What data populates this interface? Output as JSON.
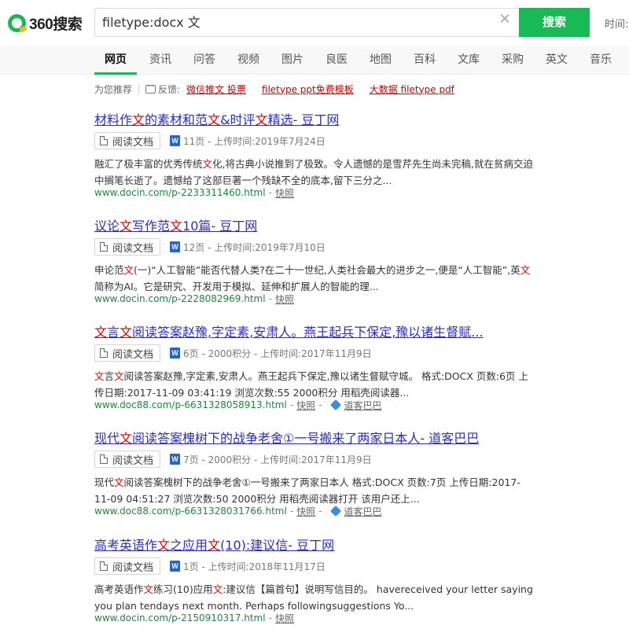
{
  "logo": {
    "text": "360搜索"
  },
  "search": {
    "query": "filetype:docx 文",
    "button_label": "搜索",
    "time_label": "时间:"
  },
  "nav": {
    "items": [
      "网页",
      "资讯",
      "问答",
      "视频",
      "图片",
      "良医",
      "地图",
      "百科",
      "文库",
      "采购",
      "英文",
      "音乐"
    ],
    "active": "网页"
  },
  "recommend": {
    "label": "为您推荐",
    "feedback_label": "反馈:",
    "links": [
      "微信推文 投票",
      "filetype ppt免费模板",
      "大数据 filetype pdf"
    ]
  },
  "results": [
    {
      "title_parts": [
        "材料作",
        "文",
        "的素材和范",
        "文",
        "&时评",
        "文",
        "精选- 豆丁网"
      ],
      "read_label": "阅读文档",
      "meta": "11页 - 上传时间:2019年7月24日",
      "snippet_parts": [
        "融汇了极丰富的优秀传统",
        "文",
        "化,将古典小说推到了极致。令人遗憾的是雪芹先生尚未完稿,就在贫病交迫中搁笔长逝了。遗憾给了这部巨著一个残缺不全的底本,留下三分之..."
      ],
      "url": "www.docin.com/p-2233311460.html",
      "snapshot": "快照",
      "site": ""
    },
    {
      "title_parts": [
        "议论",
        "文",
        "写作范",
        "文",
        "10篇- 豆丁网"
      ],
      "read_label": "阅读文档",
      "meta": "12页 - 上传时间:2019年7月10日",
      "snippet_parts": [
        "申论范",
        "文",
        "(一)“人工智能”能否代替人类?在二十一世纪,人类社会最大的进步之一,便是“人工智能”,英",
        "文",
        "简称为AI。它是研究、开发用于模拟、延伸和扩展人的智能的理..."
      ],
      "url": "www.docin.com/p-2228082969.html",
      "snapshot": "快照",
      "site": ""
    },
    {
      "title_parts": [
        "文",
        "言",
        "文",
        "阅读答案赵豫,字定素,安肃人。燕王起兵下保定,豫以诸生督赋..."
      ],
      "read_label": "阅读文档",
      "meta": "6页 - 2000积分 - 上传时间:2017年11月9日",
      "snippet_parts": [
        "文",
        "言",
        "文",
        "阅读答案赵豫,字定素,安肃人。燕王起兵下保定,豫以诸生督赋守城。 格式:DOCX 页数:6页 上传日期:2017-11-09 03:41:19 浏览次数:55 2000积分 用稻壳阅读器..."
      ],
      "url": "www.doc88.com/p-6631328058913.html",
      "snapshot": "快照",
      "site": "道客巴巴"
    },
    {
      "title_parts": [
        "现代",
        "文",
        "阅读答案槐树下的战争老舍①一号搬来了两家日本人- 道客巴巴"
      ],
      "read_label": "阅读文档",
      "meta": "7页 - 2000积分 - 上传时间:2017年11月9日",
      "snippet_parts": [
        "现代",
        "文",
        "阅读答案槐树下的战争老舍①一号搬来了两家日本人 格式:DOCX 页数:7页 上传日期:2017-11-09 04:51:27 浏览次数:50 2000积分 用稻壳阅读器打开 该用户还上..."
      ],
      "url": "www.doc88.com/p-6631328031766.html",
      "snapshot": "快照",
      "site": "道客巴巴"
    },
    {
      "title_parts": [
        "高考英语作",
        "文",
        "之应用",
        "文",
        "(10):建议信- 豆丁网"
      ],
      "read_label": "阅读文档",
      "meta": "1页 - 上传时间:2018年11月17日",
      "snippet_parts": [
        "高考英语作",
        "文",
        "练习(10)应用",
        "文",
        ":建议信【篇首句】说明写信目的。 havereceived your letter saying you plan tendays next month. Perhaps followingsuggestions Yo..."
      ],
      "url": "www.docin.com/p-2150910317.html",
      "snapshot": "快照",
      "site": ""
    }
  ]
}
